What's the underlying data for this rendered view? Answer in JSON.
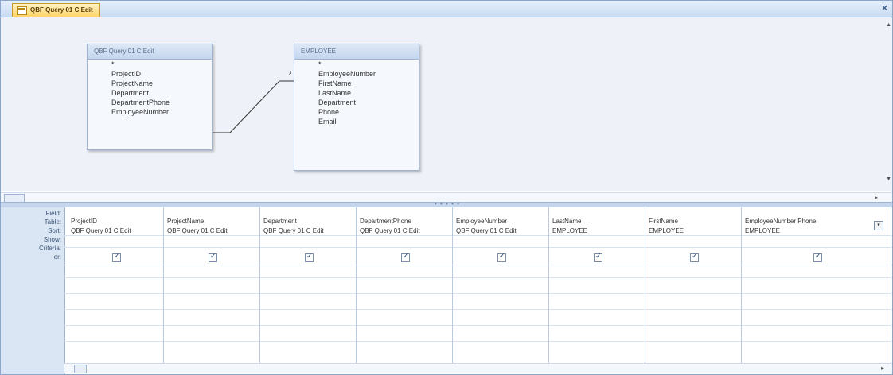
{
  "tab": {
    "label": "QBF Query 01 C Edit"
  },
  "tables": [
    {
      "title": "QBF Query 01 C Edit",
      "star": "*",
      "fields": [
        "ProjectID",
        "ProjectName",
        "Department",
        "DepartmentPhone",
        "EmployeeNumber"
      ]
    },
    {
      "title": "EMPLOYEE",
      "star": "*",
      "key_field": "EmployeeNumber",
      "fields": [
        "FirstName",
        "LastName",
        "Department",
        "Phone",
        "Email"
      ]
    }
  ],
  "row_labels": [
    "Field:",
    "Table:",
    "Sort:",
    "Show:",
    "Criteria:",
    "or:"
  ],
  "columns": [
    {
      "field": "ProjectID",
      "table": "QBF Query 01 C Edit",
      "show": true
    },
    {
      "field": "ProjectName",
      "table": "QBF Query 01 C Edit",
      "show": true
    },
    {
      "field": "Department",
      "table": "QBF Query 01 C Edit",
      "show": true
    },
    {
      "field": "DepartmentPhone",
      "table": "QBF Query 01 C Edit",
      "show": true
    },
    {
      "field": "EmployeeNumber",
      "table": "QBF Query 01 C Edit",
      "show": true
    },
    {
      "field": "LastName",
      "table": "EMPLOYEE",
      "show": true
    },
    {
      "field": "FirstName",
      "table": "EMPLOYEE",
      "show": true
    },
    {
      "field": "EmployeeNumber Phone",
      "table": "EMPLOYEE",
      "show": true
    }
  ],
  "icons": {
    "close": "close-icon",
    "tab": "query-icon"
  }
}
